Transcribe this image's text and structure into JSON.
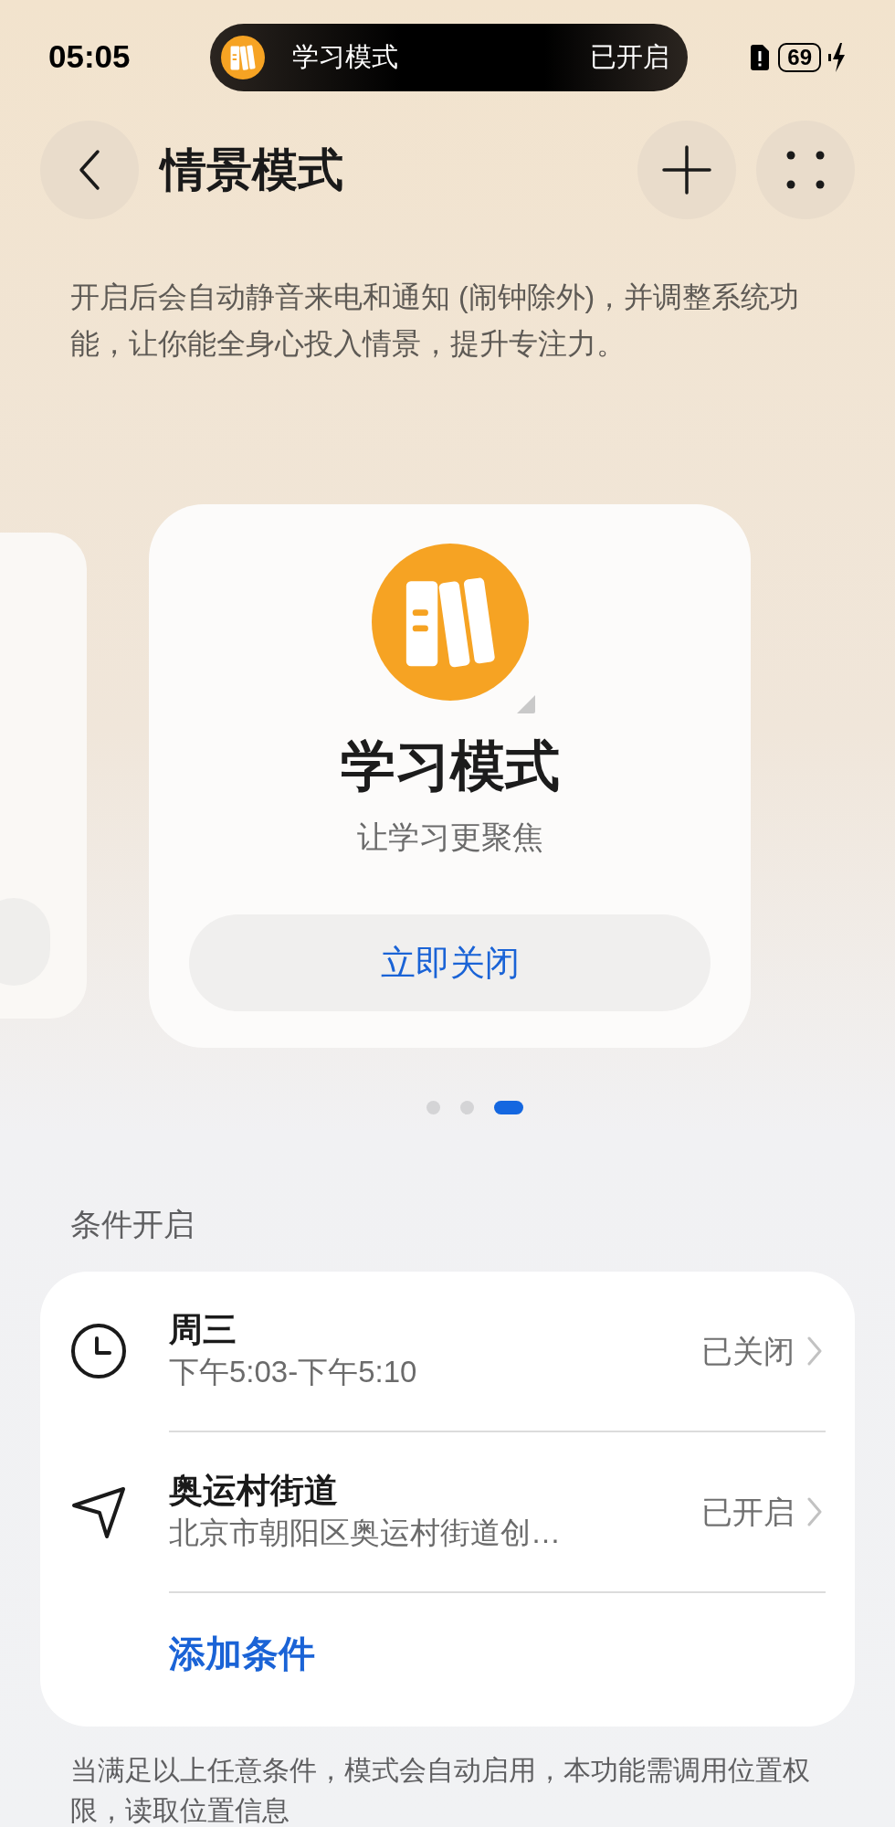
{
  "status_bar": {
    "time": "05:05",
    "live_activity": {
      "title": "学习模式",
      "status": "已开启"
    },
    "battery": "69"
  },
  "header": {
    "title": "情景模式"
  },
  "description": "开启后会自动静音来电和通知 (闹钟除外)，并调整系统功能，让你能全身心投入情景，提升专注力。",
  "carousel": {
    "card": {
      "title": "学习模式",
      "subtitle": "让学习更聚焦",
      "button": "立即关闭"
    },
    "pages": [
      {
        "selected": false
      },
      {
        "selected": false
      },
      {
        "selected": true
      }
    ]
  },
  "conditions": {
    "heading": "条件开启",
    "items": [
      {
        "kind": "time",
        "title": "周三",
        "detail": "下午5:03-下午5:10",
        "status": "已关闭"
      },
      {
        "kind": "location",
        "title": "奥运村街道",
        "detail": "北京市朝阳区奥运村街道创…",
        "status": "已开启"
      }
    ],
    "add_label": "添加条件"
  },
  "footnote": "当满足以上任意条件，模式会自动启用，本功能需调用位置权限，读取位置信息"
}
